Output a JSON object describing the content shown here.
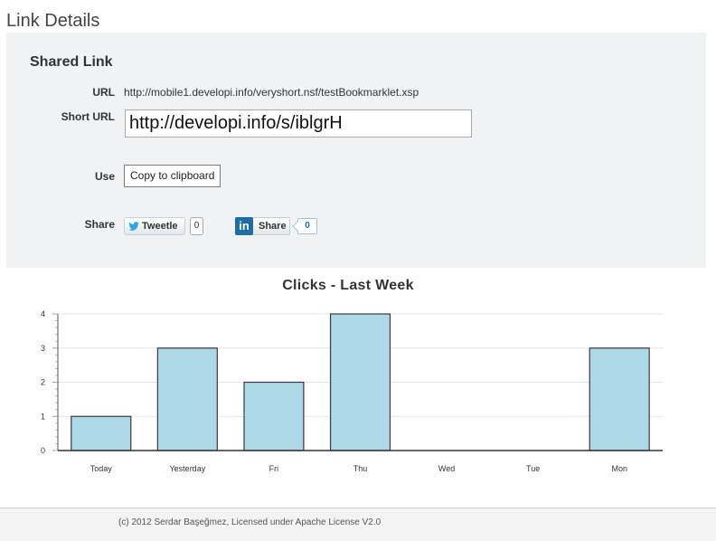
{
  "page": {
    "title": "Link Details"
  },
  "shared_link": {
    "heading": "Shared Link",
    "url_label": "URL",
    "url_value": "http://mobile1.developi.info/veryshort.nsf/testBookmarklet.xsp",
    "short_url_label": "Short URL",
    "short_url_value": "http://developi.info/s/iblgrH",
    "use_label": "Use",
    "copy_button_label": "Copy to clipboard",
    "share_label": "Share",
    "tweet_label": "Tweetle",
    "tweet_count": "0",
    "linkedin_label": "Share",
    "linkedin_count": "0",
    "icons": {
      "twitter": "twitter-bird-icon",
      "linkedin": "linkedin-logo-icon"
    }
  },
  "chart_data": {
    "type": "bar",
    "title": "Clicks - Last Week",
    "categories": [
      "Today",
      "Yesterday",
      "Fri",
      "Thu",
      "Wed",
      "Tue",
      "Mon"
    ],
    "values": [
      1,
      3,
      2,
      4,
      0,
      0,
      3
    ],
    "ylim": [
      0,
      4
    ],
    "yticks": [
      "0",
      "1",
      "2",
      "3",
      "4"
    ],
    "grid": true,
    "bar_color": "#add8e6",
    "bar_stroke": "#3a3a3a"
  },
  "footer": {
    "text": "(c) 2012 Serdar Başeğmez, Licensed under Apache License V2.0"
  }
}
